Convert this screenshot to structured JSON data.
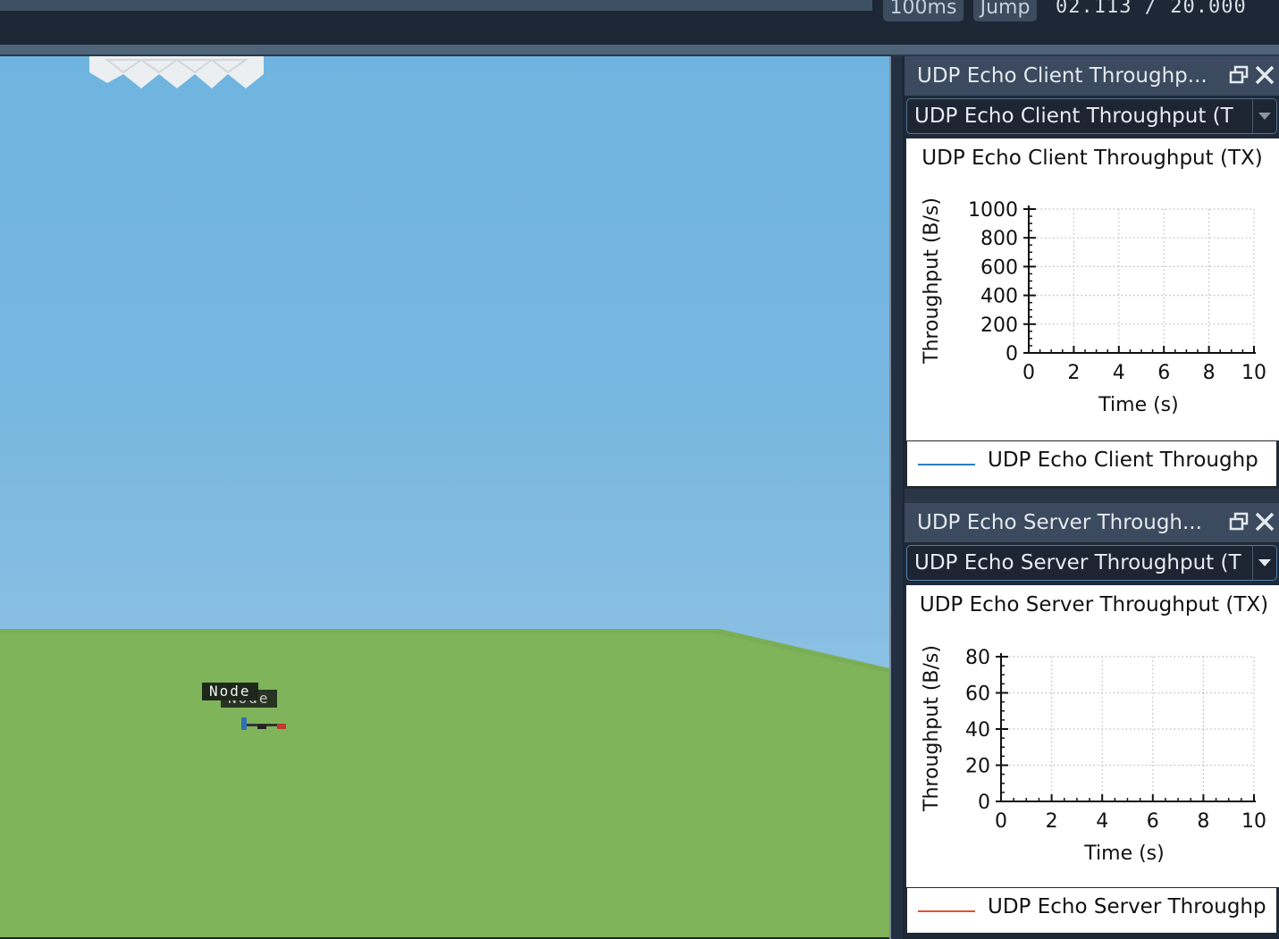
{
  "toolbar": {
    "step_size": "100ms",
    "jump_label": "Jump",
    "current_time": "02.113",
    "separator": "/",
    "end_time": "20.000"
  },
  "viewport": {
    "node_labels": [
      "Node",
      "Node"
    ],
    "sky_color": "#72b6e1",
    "ground_color": "#80b45a"
  },
  "panels": [
    {
      "title": "UDP Echo Client Throughp...",
      "selected_series": "UDP Echo Client Throughput (T",
      "legend_label": "UDP Echo Client Throughp",
      "legend_color": "#2a7fc4"
    },
    {
      "title": "UDP Echo Server Through...",
      "selected_series": "UDP Echo Server Throughput (T",
      "legend_label": "UDP Echo Server Throughp",
      "legend_color": "#e0532a"
    }
  ],
  "chart_data": [
    {
      "type": "line",
      "title": "UDP Echo Client Throughput (TX)",
      "xlabel": "Time (s)",
      "ylabel": "Throughput (B/s)",
      "xlim": [
        0,
        10
      ],
      "ylim": [
        0,
        1000
      ],
      "x_ticks": [
        0,
        2,
        4,
        6,
        8,
        10
      ],
      "y_ticks": [
        0,
        200,
        400,
        600,
        800,
        1000
      ],
      "grid": true,
      "series": [
        {
          "name": "UDP Echo Client Throughp",
          "x": [],
          "y": []
        }
      ]
    },
    {
      "type": "line",
      "title": "UDP Echo Server Throughput (TX)",
      "xlabel": "Time (s)",
      "ylabel": "Throughput (B/s)",
      "xlim": [
        0,
        10
      ],
      "ylim": [
        0,
        80
      ],
      "x_ticks": [
        0,
        2,
        4,
        6,
        8,
        10
      ],
      "y_ticks": [
        0,
        20,
        40,
        60,
        80
      ],
      "grid": true,
      "series": [
        {
          "name": "UDP Echo Server Throughp",
          "x": [],
          "y": []
        }
      ]
    }
  ]
}
